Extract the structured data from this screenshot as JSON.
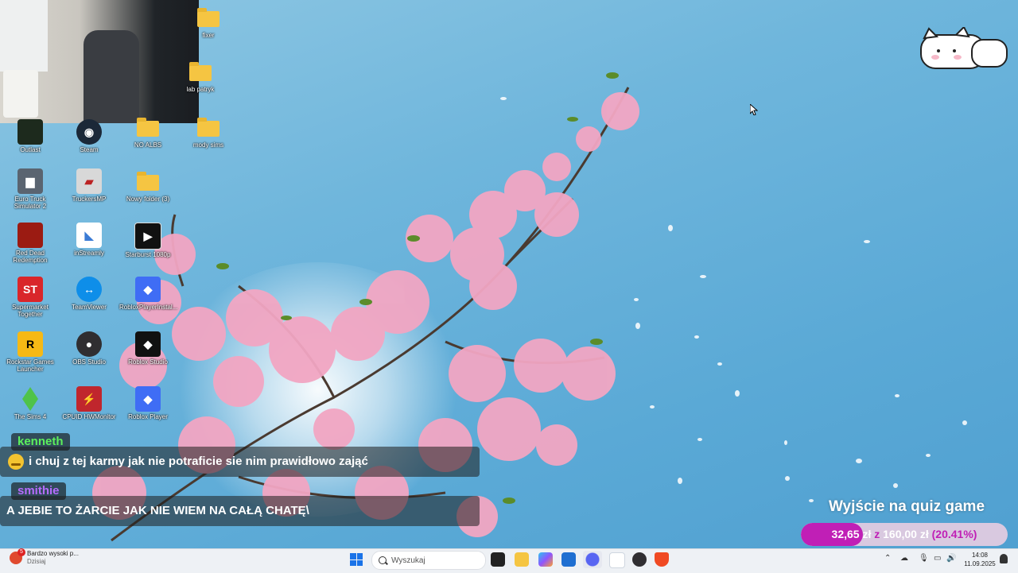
{
  "desktop": {
    "icons_col1": [
      {
        "label": "Outlast"
      },
      {
        "label": "Euro Truck Simulator 2"
      },
      {
        "label": "Red Dead Redemption"
      },
      {
        "label": "Supermarket Together"
      },
      {
        "label": "Rockstar Games Launcher"
      },
      {
        "label": "The Sims 4"
      }
    ],
    "icons_col2": [
      {
        "label": "Steam"
      },
      {
        "label": "TruckersMP"
      },
      {
        "label": "inStreamly"
      },
      {
        "label": "TeamViewer"
      },
      {
        "label": "OBS Studio"
      },
      {
        "label": "CPUID HWMonitor"
      }
    ],
    "icons_col3": [
      {
        "label": "NO ALBS"
      },
      {
        "label": "Nowy folder (3)"
      },
      {
        "label": "Starburst 1080p"
      },
      {
        "label": "RobloxPlayerInstal..."
      },
      {
        "label": "Roblox Studio"
      },
      {
        "label": "Roblox Player"
      }
    ],
    "icons_col4": [
      {
        "label": "fixer"
      },
      {
        "label": "lab patryk"
      },
      {
        "label": "mody sims"
      }
    ]
  },
  "chat": {
    "messages": [
      {
        "user": "kenneth",
        "text": "i chuj z tej karmy jak nie potraficie sie nim prawidłowo zająć",
        "color": "#5cf05c"
      },
      {
        "user": "smithie",
        "text": "A JEBIE TO ŻARCIE JAK NIE WIEM NA CAŁĄ CHATĘ\\",
        "color": "#b66cff"
      }
    ]
  },
  "goal": {
    "title": "Wyjście na quiz game",
    "current": "32,65 zł",
    "separator": "z",
    "target": "160,00 zł",
    "percent": "(20.41%)",
    "fill_fraction": 0.2041
  },
  "taskbar": {
    "weather_title": "Bardzo wysoki p...",
    "weather_sub": "Dzisiaj",
    "weather_badge": "5",
    "search_placeholder": "Wyszukaj",
    "time": "14:08",
    "date": "11.09.2025"
  },
  "colors": {
    "accent_goal": "#c01fb6",
    "taskbar_bg": "#eef1f5"
  }
}
